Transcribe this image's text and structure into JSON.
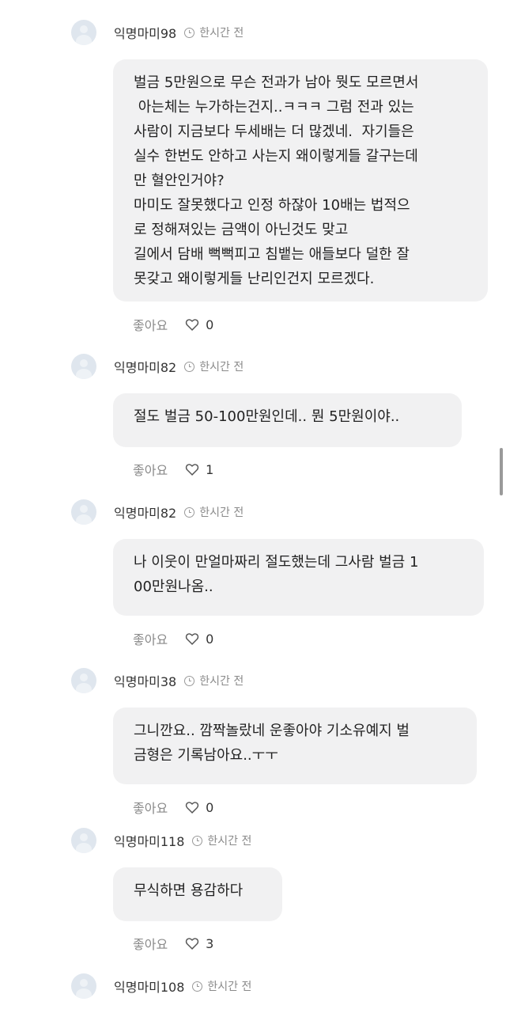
{
  "like_label": "좋아요",
  "comments": [
    {
      "nick": "익명마미98",
      "time": "한시간 전",
      "text": "벌금 5만원으로 무슨 전과가 남아 뭣도 모르면서\n 아는체는 누가하는건지..ㅋㅋㅋ 그럼 전과 있는\n사람이 지금보다 두세배는 더 많겠네.  자기들은\n실수 한번도 안하고 사는지 왜이렇게들 갈구는데\n만 혈안인거야?\n마미도 잘못했다고 인정 하잖아 10배는 법적으\n로 정해져있는 금액이 아닌것도 맞고\n길에서 담배 뻑뻑피고 침뱉는 애들보다 덜한 잘\n못갖고 왜이렇게들 난리인건지 모르겠다.",
      "likes": "0"
    },
    {
      "nick": "익명마미82",
      "time": "한시간 전",
      "text": "절도 벌금 50-100만원인데.. 뭔 5만원이야..",
      "likes": "1"
    },
    {
      "nick": "익명마미82",
      "time": "한시간 전",
      "text": "나 이웃이 만얼마짜리 절도했는데 그사람 벌금 1\n00만원나옴..",
      "likes": "0"
    },
    {
      "nick": "익명마미38",
      "time": "한시간 전",
      "text": "그니깐요.. 깜짝놀랐네 운좋아야 기소유예지 벌\n금형은 기록남아요..ㅜㅜ",
      "likes": "0"
    },
    {
      "nick": "익명마미118",
      "time": "한시간 전",
      "text": "무식하면 용감하다",
      "likes": "3"
    },
    {
      "nick": "익명마미108",
      "time": "한시간 전"
    }
  ]
}
